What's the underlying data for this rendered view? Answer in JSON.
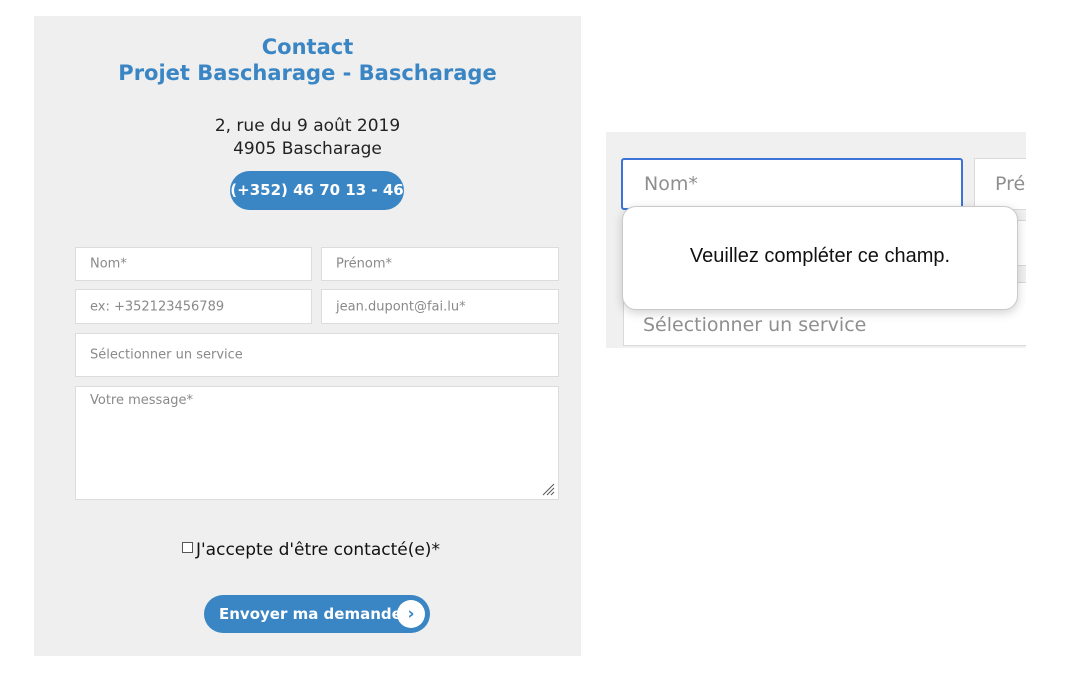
{
  "contact": {
    "title": "Contact",
    "subtitle": "Projet Bascharage - Bascharage",
    "address_line1": "2, rue du 9 août 2019",
    "address_line2": "4905 Bascharage",
    "phone": "(+352) 46 70 13 - 46"
  },
  "form": {
    "nom_placeholder": "Nom*",
    "prenom_placeholder": "Prénom*",
    "tel_placeholder": "ex: +352123456789",
    "email_placeholder": "jean.dupont@fai.lu*",
    "service_placeholder": "Sélectionner un service",
    "message_placeholder": "Votre message*",
    "consent_label": "J'accepte d'être contacté(e)*",
    "consent_checked": false,
    "submit_label": "Envoyer ma demande",
    "submit_icon": "chevron-right-icon"
  },
  "zoom": {
    "nom_placeholder": "Nom*",
    "prenom_placeholder": "Pré",
    "service_placeholder": "Sélectionner un service",
    "validation_message": "Veuillez compléter ce champ."
  },
  "colors": {
    "accent": "#3a86c4",
    "panel_bg": "#efefef",
    "focus_border": "#3b74d6"
  }
}
